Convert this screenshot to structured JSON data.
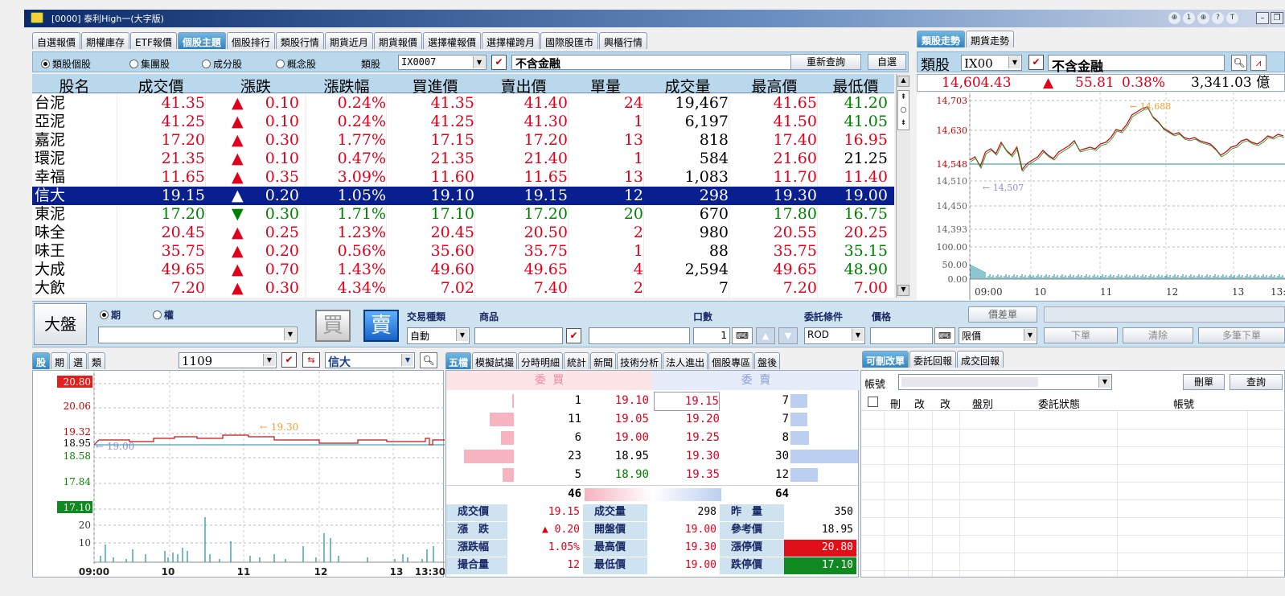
{
  "window": {
    "title": "[0000] 泰利High一(大字版)",
    "icons": [
      "⊕",
      "1",
      "⊕",
      "?",
      "T"
    ]
  },
  "top_tabs": [
    "自選報價",
    "期權庫存",
    "ETF報價",
    "個股主題",
    "個股排行",
    "類股行情",
    "期貨近月",
    "期貨報價",
    "選擇權報價",
    "選擇權跨月",
    "國際股匯市",
    "興櫃行情"
  ],
  "top_tab_active": 3,
  "filter": {
    "radios": [
      "類股個股",
      "集團股",
      "成分股",
      "概念股"
    ],
    "radio_selected": 0,
    "sector_label": "類股",
    "sector_value": "IX0007",
    "sector_name": "不含金融",
    "refresh_button": "重新查詢",
    "select_button": "自選"
  },
  "table": {
    "headers": [
      "股名",
      "成交價",
      "漲跌",
      "漲跌幅",
      "買進價",
      "賣出價",
      "單量",
      "成交量",
      "最高價",
      "最低價"
    ],
    "rows": [
      {
        "name": "台泥",
        "price": "41.35",
        "dir": "▲",
        "chg": "0.10",
        "pct": "0.24%",
        "bid": "41.35",
        "ask": "41.40",
        "vol": "24",
        "total": "19,467",
        "high": "41.65",
        "low": "41.20",
        "color": "red",
        "low_color": "green"
      },
      {
        "name": "亞泥",
        "price": "41.25",
        "dir": "▲",
        "chg": "0.10",
        "pct": "0.24%",
        "bid": "41.25",
        "ask": "41.30",
        "vol": "1",
        "total": "6,197",
        "high": "41.50",
        "low": "41.05",
        "color": "red",
        "low_color": "green"
      },
      {
        "name": "嘉泥",
        "price": "17.20",
        "dir": "▲",
        "chg": "0.30",
        "pct": "1.77%",
        "bid": "17.15",
        "ask": "17.20",
        "vol": "13",
        "total": "818",
        "high": "17.40",
        "low": "16.95",
        "color": "red",
        "low_color": "red"
      },
      {
        "name": "環泥",
        "price": "21.35",
        "dir": "▲",
        "chg": "0.10",
        "pct": "0.47%",
        "bid": "21.35",
        "ask": "21.40",
        "vol": "1",
        "total": "584",
        "high": "21.60",
        "low": "21.25",
        "color": "red",
        "low_color": "blk"
      },
      {
        "name": "幸福",
        "price": "11.65",
        "dir": "▲",
        "chg": "0.35",
        "pct": "3.09%",
        "bid": "11.60",
        "ask": "11.65",
        "vol": "13",
        "total": "1,083",
        "high": "11.70",
        "low": "11.40",
        "color": "red",
        "low_color": "red"
      },
      {
        "name": "信大",
        "price": "19.15",
        "dir": "▲",
        "chg": "0.20",
        "pct": "1.05%",
        "bid": "19.10",
        "ask": "19.15",
        "vol": "12",
        "total": "298",
        "high": "19.30",
        "low": "19.00",
        "color": "red",
        "low_color": "red"
      },
      {
        "name": "東泥",
        "price": "17.20",
        "dir": "▼",
        "chg": "0.30",
        "pct": "1.71%",
        "bid": "17.10",
        "ask": "17.20",
        "vol": "20",
        "total": "670",
        "high": "17.80",
        "low": "16.75",
        "color": "green",
        "low_color": "green"
      },
      {
        "name": "味全",
        "price": "20.45",
        "dir": "▲",
        "chg": "0.25",
        "pct": "1.23%",
        "bid": "20.45",
        "ask": "20.50",
        "vol": "2",
        "total": "980",
        "high": "20.55",
        "low": "20.25",
        "color": "red",
        "low_color": "red"
      },
      {
        "name": "味王",
        "price": "35.75",
        "dir": "▲",
        "chg": "0.20",
        "pct": "0.56%",
        "bid": "35.60",
        "ask": "35.75",
        "vol": "1",
        "total": "88",
        "high": "35.75",
        "low": "35.15",
        "color": "red",
        "low_color": "green"
      },
      {
        "name": "大成",
        "price": "49.65",
        "dir": "▲",
        "chg": "0.70",
        "pct": "1.43%",
        "bid": "49.60",
        "ask": "49.65",
        "vol": "4",
        "total": "2,594",
        "high": "49.65",
        "low": "48.90",
        "color": "red",
        "low_color": "green"
      },
      {
        "name": "大飲",
        "price": "7.20",
        "dir": "▲",
        "chg": "0.30",
        "pct": "4.34%",
        "bid": "7.02",
        "ask": "7.40",
        "vol": "2",
        "total": "7",
        "high": "7.20",
        "low": "7.00",
        "color": "red",
        "low_color": "red"
      }
    ],
    "selected_row": 5
  },
  "right_tabs": [
    "類股走勢",
    "期貨走勢"
  ],
  "right_tab_active": 0,
  "sector_chart": {
    "label": "類股",
    "code": "IX00",
    "name": "不含金融",
    "index": "14,604.43",
    "dir": "▲",
    "chg": "55.81",
    "pct": "0.38%",
    "volume": "3,341.03 億",
    "y_ticks": [
      "14,703",
      "14,630",
      "14,548",
      "14,510",
      "14,450",
      "14,393"
    ],
    "vol_ticks": [
      "100.00",
      "50.00",
      "0.00"
    ],
    "x_ticks": [
      "09:00",
      "10",
      "11",
      "12",
      "13",
      "13:"
    ],
    "high_label": "14,688",
    "low_label": "14,507"
  },
  "order": {
    "market_button": "大盤",
    "radio_options": [
      "期",
      "權"
    ],
    "radio_selected": 0,
    "buy_label": "買",
    "sell_label": "賣",
    "trade_type_label": "交易種類",
    "trade_type_value": "自動",
    "product_label": "商品",
    "lots_label": "口數",
    "lots_value": "1",
    "condition_label": "委託條件",
    "condition_value": "ROD",
    "price_label": "價格",
    "price_type": "限價",
    "spread_button": "價差單",
    "submit_button": "下單",
    "clear_button": "清除",
    "multi_button": "多筆下單"
  },
  "stock_panel": {
    "tabs": [
      "股",
      "期",
      "選",
      "類"
    ],
    "code": "1109",
    "name": "信大",
    "y_ticks": [
      "20.80",
      "20.06",
      "19.32",
      "18.95",
      "18.58",
      "17.84",
      "17.10"
    ],
    "vol_ticks": [
      "20",
      "10"
    ],
    "x_ticks": [
      "09:00",
      "10",
      "11",
      "12",
      "13",
      "13:30"
    ],
    "high_label": "19.30",
    "low_label": "19.00",
    "limit_up": "20.80",
    "limit_down": "17.10"
  },
  "five_levels": {
    "tabs": [
      "五檔",
      "模擬試撮",
      "分時明細",
      "統計",
      "新聞",
      "技術分析",
      "法人進出",
      "個股專區",
      "盤後"
    ],
    "buy_title": "委 買",
    "sell_title": "委 賣",
    "levels": [
      {
        "bid_qty": "1",
        "bid": "19.10",
        "ask": "19.15",
        "ask_qty": "7",
        "bid_color": "red",
        "bid_w": 0.04,
        "ask_w": 0.25
      },
      {
        "bid_qty": "11",
        "bid": "19.05",
        "ask": "19.20",
        "ask_qty": "7",
        "bid_color": "red",
        "bid_w": 0.48,
        "ask_w": 0.25
      },
      {
        "bid_qty": "6",
        "bid": "19.00",
        "ask": "19.25",
        "ask_qty": "8",
        "bid_color": "red",
        "bid_w": 0.26,
        "ask_w": 0.27
      },
      {
        "bid_qty": "23",
        "bid": "18.95",
        "ask": "19.30",
        "ask_qty": "30",
        "bid_color": "blk",
        "bid_w": 1.0,
        "ask_w": 1.0
      },
      {
        "bid_qty": "5",
        "bid": "18.90",
        "ask": "19.35",
        "ask_qty": "12",
        "bid_color": "green",
        "bid_w": 0.22,
        "ask_w": 0.4
      }
    ],
    "bid_total": "46",
    "ask_total": "64",
    "info": [
      [
        "成交價",
        "19.15",
        "成交量",
        "298",
        "昨　量",
        "350"
      ],
      [
        "漲　跌",
        "▲  0.20",
        "開盤價",
        "19.00",
        "參考價",
        "18.95"
      ],
      [
        "漲跌幅",
        "1.05%",
        "最高價",
        "19.30",
        "漲停價",
        "20.80"
      ],
      [
        "撮合量",
        "12",
        "最低價",
        "19.00",
        "跌停價",
        "17.10"
      ]
    ]
  },
  "orders_panel": {
    "tabs": [
      "可刪改單",
      "委託回報",
      "成交回報"
    ],
    "account_label": "帳號",
    "delete_button": "刪單",
    "query_button": "查詢",
    "headers": [
      "刪",
      "改",
      "改",
      "盤別",
      "委託狀態",
      "帳號"
    ]
  }
}
